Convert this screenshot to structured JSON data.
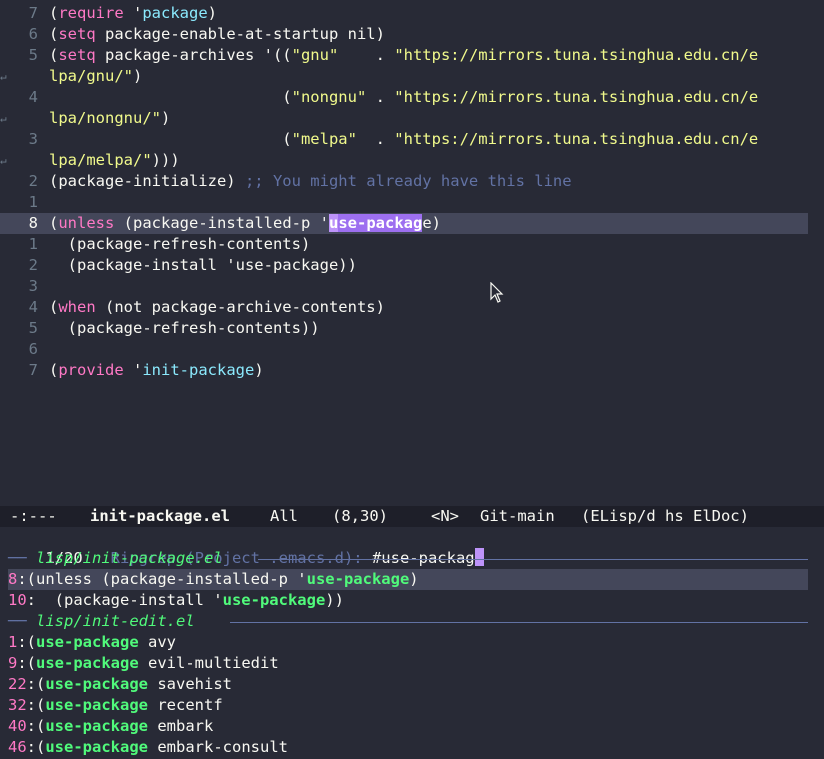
{
  "editor": {
    "lines": [
      {
        "num": "7",
        "segments": [
          [
            "(",
            ""
          ],
          [
            "require",
            "kw"
          ],
          [
            " '",
            ""
          ],
          [
            "package",
            "sym"
          ],
          [
            ")",
            ""
          ]
        ]
      },
      {
        "num": "6",
        "segments": [
          [
            "(",
            ""
          ],
          [
            "setq",
            "kw"
          ],
          [
            " package-enable-at-startup nil)",
            ""
          ]
        ]
      },
      {
        "num": "5",
        "segments": [
          [
            "(",
            ""
          ],
          [
            "setq",
            "kw"
          ],
          [
            " package-archives '((",
            ""
          ],
          [
            "\"gnu\"",
            "str"
          ],
          [
            "    . ",
            ""
          ],
          [
            "\"https://mirrors.tuna.tsinghua.edu.cn/e",
            "str"
          ]
        ]
      },
      {
        "num": "",
        "wrap": true,
        "segments": [
          [
            "lpa/gnu/\"",
            "str"
          ],
          [
            ")",
            ""
          ]
        ]
      },
      {
        "num": "4",
        "segments": [
          [
            "                         (",
            ""
          ],
          [
            "\"nongnu\"",
            "str"
          ],
          [
            " . ",
            ""
          ],
          [
            "\"https://mirrors.tuna.tsinghua.edu.cn/e",
            "str"
          ]
        ]
      },
      {
        "num": "",
        "wrap": true,
        "segments": [
          [
            "lpa/nongnu/\"",
            "str"
          ],
          [
            ")",
            ""
          ]
        ]
      },
      {
        "num": "3",
        "segments": [
          [
            "                         (",
            ""
          ],
          [
            "\"melpa\"",
            "str"
          ],
          [
            "  . ",
            ""
          ],
          [
            "\"https://mirrors.tuna.tsinghua.edu.cn/e",
            "str"
          ]
        ]
      },
      {
        "num": "",
        "wrap": true,
        "segments": [
          [
            "lpa/melpa/\"",
            "str"
          ],
          [
            ")))",
            ""
          ]
        ]
      },
      {
        "num": "2",
        "segments": [
          [
            "(package-initialize) ",
            ""
          ],
          [
            ";; You might already have this line",
            "cmt"
          ]
        ]
      },
      {
        "num": "1",
        "segments": []
      },
      {
        "num": "8",
        "current": true,
        "segments": [
          [
            "(",
            ""
          ],
          [
            "unless",
            "kw"
          ],
          [
            " (package-installed-p '",
            ""
          ],
          [
            "u",
            "hlc"
          ],
          [
            "se-packag",
            "hl"
          ],
          [
            "e)",
            ""
          ]
        ]
      },
      {
        "num": "1",
        "segments": [
          [
            "  (package-refresh-contents)",
            ""
          ]
        ]
      },
      {
        "num": "2",
        "segments": [
          [
            "  (package-install 'use-package))",
            ""
          ]
        ]
      },
      {
        "num": "3",
        "segments": []
      },
      {
        "num": "4",
        "segments": [
          [
            "(",
            ""
          ],
          [
            "when",
            "kw"
          ],
          [
            " (not package-archive-contents)",
            ""
          ]
        ]
      },
      {
        "num": "5",
        "segments": [
          [
            "  (package-refresh-contents))",
            ""
          ]
        ]
      },
      {
        "num": "6",
        "segments": []
      },
      {
        "num": "7",
        "segments": [
          [
            "(",
            ""
          ],
          [
            "provide",
            "kw"
          ],
          [
            " '",
            ""
          ],
          [
            "init-package",
            "sym"
          ],
          [
            ")",
            ""
          ]
        ]
      }
    ]
  },
  "mode_line": {
    "state": "-:---",
    "buffer": "init-package.el",
    "position": "All",
    "cursor": "(8,30)",
    "evil_state": "<N>",
    "vc": "Git-main",
    "modes": "(ELisp/d hs ElDoc)"
  },
  "minibuffer": {
    "count": "1/20",
    "prompt": "Ripgrep (Project .emacs.d):",
    "input": "#use-packag",
    "groups": [
      {
        "file": "lisp/init-package.el",
        "results": [
          {
            "line": "8",
            "pre": ":(unless (package-installed-p '",
            "match": "use-package",
            "post": ")",
            "selected": true
          },
          {
            "line": "10",
            "pre": ":  (package-install '",
            "match": "use-package",
            "post": "))"
          }
        ]
      },
      {
        "file": "lisp/init-edit.el",
        "results": [
          {
            "line": "1",
            "pre": ":(",
            "match": "use-package",
            "post": " avy"
          },
          {
            "line": "9",
            "pre": ":(",
            "match": "use-package",
            "post": " evil-multiedit"
          },
          {
            "line": "22",
            "pre": ":(",
            "match": "use-package",
            "post": " savehist"
          },
          {
            "line": "32",
            "pre": ":(",
            "match": "use-package",
            "post": " recentf"
          },
          {
            "line": "40",
            "pre": ":(",
            "match": "use-package",
            "post": " embark"
          },
          {
            "line": "46",
            "pre": ":(",
            "match": "use-package",
            "post": " embark-consult"
          }
        ]
      }
    ]
  },
  "icons": {
    "wrap": "line-wrap-icon",
    "pointer": "mouse-pointer-icon"
  },
  "colors": {
    "background": "#282a36",
    "keyword": "#ff79c6",
    "string": "#f1fa8c",
    "comment": "#6272a4",
    "match": "#50fa7b",
    "highlight": "#bd93f9"
  }
}
